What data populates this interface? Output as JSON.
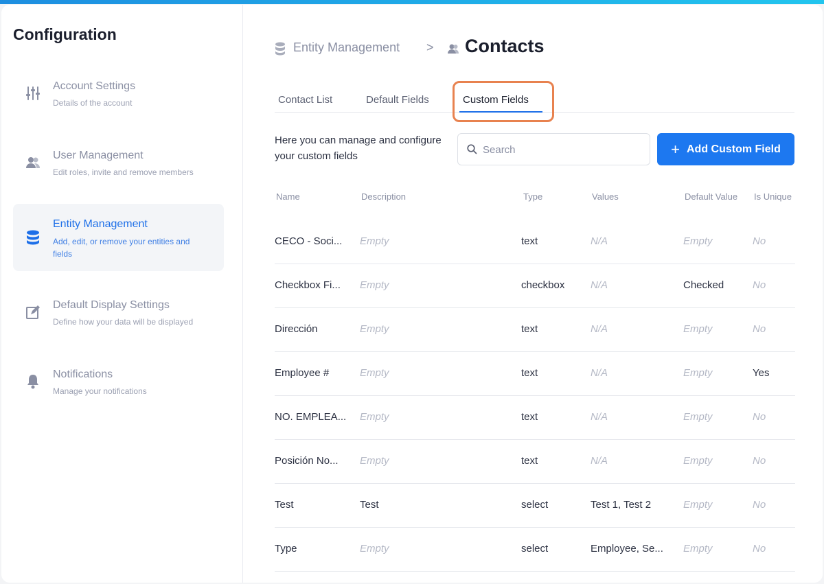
{
  "sidebar": {
    "title": "Configuration",
    "items": [
      {
        "label": "Account Settings",
        "desc": "Details of the account",
        "icon": "sliders-icon"
      },
      {
        "label": "User Management",
        "desc": "Edit roles, invite and remove members",
        "icon": "users-icon"
      },
      {
        "label": "Entity Management",
        "desc": "Add, edit, or remove your entities and fields",
        "icon": "database-icon",
        "active": true
      },
      {
        "label": "Default Display Settings",
        "desc": "Define how your data will be displayed",
        "icon": "edit-icon"
      },
      {
        "label": "Notifications",
        "desc": "Manage your notifications",
        "icon": "bell-icon"
      }
    ]
  },
  "breadcrumb": {
    "root": "Entity Management",
    "separator": ">",
    "current": "Contacts"
  },
  "tabs": [
    {
      "label": "Contact List"
    },
    {
      "label": "Default Fields"
    },
    {
      "label": "Custom Fields",
      "active": true
    }
  ],
  "intro_text": "Here you can manage and configure your custom fields",
  "search": {
    "placeholder": "Search",
    "value": ""
  },
  "add_button": {
    "label": "Add Custom Field"
  },
  "table": {
    "headers": [
      "Name",
      "Description",
      "Type",
      "Values",
      "Default Value",
      "Is Unique"
    ],
    "rows": [
      [
        "CECO - Soci...",
        "Empty",
        "text",
        "N/A",
        "Empty",
        "No"
      ],
      [
        "Checkbox Fi...",
        "Empty",
        "checkbox",
        "N/A",
        "Checked",
        "No"
      ],
      [
        "Dirección",
        "Empty",
        "text",
        "N/A",
        "Empty",
        "No"
      ],
      [
        "Employee #",
        "Empty",
        "text",
        "N/A",
        "Empty",
        "Yes"
      ],
      [
        "NO. EMPLEA...",
        "Empty",
        "text",
        "N/A",
        "Empty",
        "No"
      ],
      [
        "Posición No...",
        "Empty",
        "text",
        "N/A",
        "Empty",
        "No"
      ],
      [
        "Test",
        "Test",
        "select",
        "Test 1, Test 2",
        "Empty",
        "No"
      ],
      [
        "Type",
        "Empty",
        "select",
        "Employee, Se...",
        "Empty",
        "No"
      ]
    ]
  },
  "colors": {
    "accent": "#1d78f0",
    "highlight": "#e8824f",
    "muted": "#8a8fa3"
  }
}
